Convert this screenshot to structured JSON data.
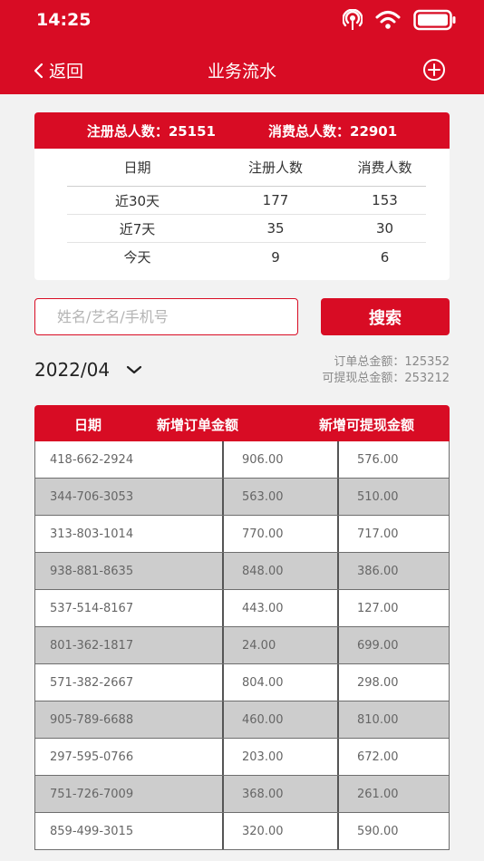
{
  "status": {
    "time": "14:25"
  },
  "nav": {
    "back_label": "返回",
    "title": "业务流水"
  },
  "stats": {
    "registered_total": "注册总人数：25151",
    "consumer_total": "消费总人数：22901",
    "columns": [
      "日期",
      "注册人数",
      "消费人数"
    ],
    "rows": [
      {
        "period": "近30天",
        "registered": "177",
        "consumers": "153"
      },
      {
        "period": "近7天",
        "registered": "35",
        "consumers": "30"
      },
      {
        "period": "今天",
        "registered": "9",
        "consumers": "6"
      }
    ]
  },
  "search": {
    "placeholder": "姓名/艺名/手机号",
    "button_label": "搜索"
  },
  "filter": {
    "month": "2022/04",
    "order_total": "订单总金额：125352",
    "withdrawable_total": "可提现总金额：253212"
  },
  "table": {
    "columns": [
      "日期",
      "新增订单金额",
      "新增可提现金额"
    ],
    "rows": [
      {
        "date": "418-662-2924",
        "order": "906.00",
        "withdraw": "576.00"
      },
      {
        "date": "344-706-3053",
        "order": "563.00",
        "withdraw": "510.00"
      },
      {
        "date": "313-803-1014",
        "order": "770.00",
        "withdraw": "717.00"
      },
      {
        "date": "938-881-8635",
        "order": "848.00",
        "withdraw": "386.00"
      },
      {
        "date": "537-514-8167",
        "order": "443.00",
        "withdraw": "127.00"
      },
      {
        "date": "801-362-1817",
        "order": "24.00",
        "withdraw": "699.00"
      },
      {
        "date": "571-382-2667",
        "order": "804.00",
        "withdraw": "298.00"
      },
      {
        "date": "905-789-6688",
        "order": "460.00",
        "withdraw": "810.00"
      },
      {
        "date": "297-595-0766",
        "order": "203.00",
        "withdraw": "672.00"
      },
      {
        "date": "751-726-7009",
        "order": "368.00",
        "withdraw": "261.00"
      },
      {
        "date": "859-499-3015",
        "order": "320.00",
        "withdraw": "590.00"
      }
    ]
  },
  "icons": {
    "signal": "hotspot-icon",
    "wifi": "wifi-icon",
    "battery": "battery-icon",
    "back": "chevron-left-icon",
    "add": "plus-circle-icon",
    "dropdown": "chevron-down-icon"
  },
  "colors": {
    "primary": "#d80c24",
    "stripe": "#cdcdcd"
  }
}
